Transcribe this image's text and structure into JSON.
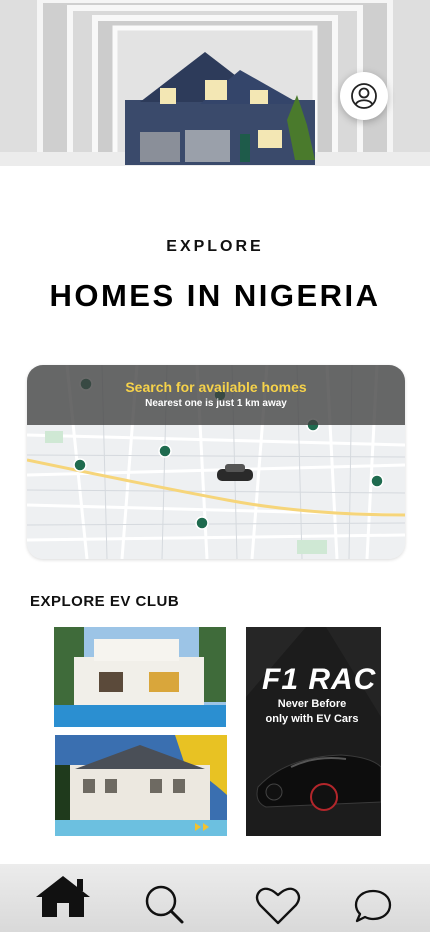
{
  "header": {
    "profile_icon": "user-circle-icon"
  },
  "hero": {
    "image": "house-hero-image"
  },
  "explore": {
    "kicker": "EXPLORE",
    "title": "HOMES IN NIGERIA"
  },
  "map_card": {
    "headline": "Search for available homes",
    "subline": "Nearest one is just 1 km away",
    "headline_color": "#f6d24a",
    "marker_color": "#1f6b4f"
  },
  "ev_club": {
    "title": "EXPLORE EV CLUB",
    "promo_title": "F1 RAC",
    "promo_subtitle_line1": "Never Before",
    "promo_subtitle_line2": "only with EV Cars"
  },
  "bottom_nav": {
    "items": [
      {
        "name": "home",
        "icon": "home-icon",
        "active": true
      },
      {
        "name": "search",
        "icon": "search-icon",
        "active": false
      },
      {
        "name": "favorites",
        "icon": "heart-icon",
        "active": false
      },
      {
        "name": "messages",
        "icon": "chat-icon",
        "active": false
      }
    ]
  }
}
